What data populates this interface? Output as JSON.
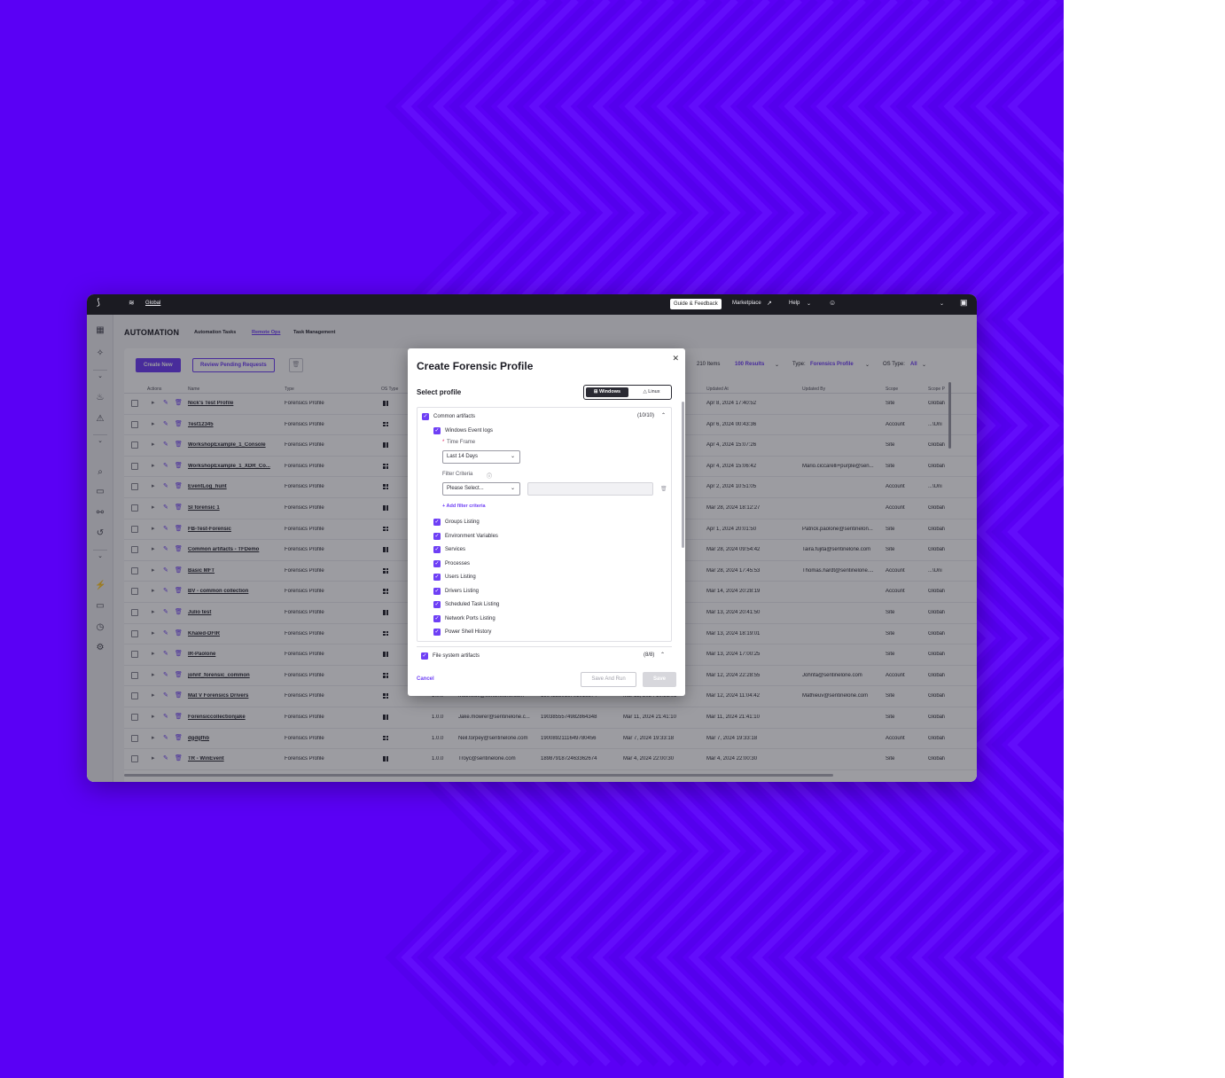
{
  "topbar": {
    "scope_label": "Global",
    "guide_label": "Guide & Feedback",
    "marketplace_label": "Marketplace",
    "help_label": "Help"
  },
  "page": {
    "title": "AUTOMATION",
    "tabs": [
      {
        "label": "Automation Tasks"
      },
      {
        "label": "Remote Ops"
      },
      {
        "label": "Task Management"
      }
    ]
  },
  "toolbar": {
    "create_label": "Create New",
    "review_label": "Review Pending Requests",
    "items_count": "210 Items",
    "results_label": "100 Results",
    "type_label": "Type:",
    "type_value": "Forensics Profile",
    "os_label": "OS Type:",
    "os_value": "All"
  },
  "table": {
    "headers": {
      "actions": "Actions",
      "name": "Name",
      "type": "Type",
      "os_type": "OS Type",
      "updated_at": "Updated At",
      "updated_by": "Updated By",
      "scope": "Scope",
      "scope_path": "Scope P"
    },
    "rows": [
      {
        "name": "Nick's Test Profile",
        "type": "Forensics Profile",
        "version": "",
        "created_by": "",
        "id": "",
        "created_at": "",
        "updated_at": "Apr 8, 2024 17:40:52",
        "updated_by": "",
        "scope": "Site",
        "path": "Global\\"
      },
      {
        "name": "Test12345",
        "type": "Forensics Profile",
        "version": "",
        "created_by": "",
        "id": "",
        "created_at": "",
        "updated_at": "Apr 6, 2024 00:43:36",
        "updated_by": "",
        "scope": "Account",
        "path": "...\\Uni"
      },
      {
        "name": "WorkshopExample_1_Console",
        "type": "Forensics Profile",
        "version": "",
        "created_by": "",
        "id": "",
        "created_at": "",
        "updated_at": "Apr 4, 2024 15:07:26",
        "updated_by": "",
        "scope": "Site",
        "path": "Global\\"
      },
      {
        "name": "WorkshopExample_1_XDR_Co...",
        "type": "Forensics Profile",
        "version": "",
        "created_by": "",
        "id": "",
        "created_at": "",
        "updated_at": "Apr 4, 2024 15:06:42",
        "updated_by": "Mario.ciccarelli+purple@sen...",
        "scope": "Site",
        "path": "Global\\"
      },
      {
        "name": "EventLog_hunt",
        "type": "Forensics Profile",
        "version": "",
        "created_by": "",
        "id": "",
        "created_at": "",
        "updated_at": "Apr 2, 2024 10:51:05",
        "updated_by": "",
        "scope": "Account",
        "path": "...\\Uni"
      },
      {
        "name": "SI forensic 1",
        "type": "Forensics Profile",
        "version": "",
        "created_by": "",
        "id": "",
        "created_at": "",
        "updated_at": "Mar 28, 2024 18:12:27",
        "updated_by": "",
        "scope": "Account",
        "path": "Global\\"
      },
      {
        "name": "FB-Test-Forensic",
        "type": "Forensics Profile",
        "version": "",
        "created_by": "",
        "id": "",
        "created_at": "",
        "updated_at": "Apr 1, 2024 20:01:50",
        "updated_by": "Patrick.paolone@sentinelon...",
        "scope": "Site",
        "path": "Global\\"
      },
      {
        "name": "Common artifacts - TFDemo",
        "type": "Forensics Profile",
        "version": "",
        "created_by": "",
        "id": "",
        "created_at": "",
        "updated_at": "Mar 28, 2024 09:54:42",
        "updated_by": "Taira.fujita@sentinelone.com",
        "scope": "Site",
        "path": "Global\\"
      },
      {
        "name": "Basic MFT",
        "type": "Forensics Profile",
        "version": "",
        "created_by": "",
        "id": "",
        "created_at": "",
        "updated_at": "Mar 28, 2024 17:45:53",
        "updated_by": "Thomas.hardt@sentinelone....",
        "scope": "Account",
        "path": "...\\Uni"
      },
      {
        "name": "BV - common collection",
        "type": "Forensics Profile",
        "version": "",
        "created_by": "",
        "id": "",
        "created_at": "",
        "updated_at": "Mar 14, 2024 20:28:19",
        "updated_by": "",
        "scope": "Account",
        "path": "Global\\"
      },
      {
        "name": "Julio test",
        "type": "Forensics Profile",
        "version": "",
        "created_by": "",
        "id": "",
        "created_at": "",
        "updated_at": "Mar 13, 2024 20:41:50",
        "updated_by": "",
        "scope": "Site",
        "path": "Global\\"
      },
      {
        "name": "Khaled-DFIR",
        "type": "Forensics Profile",
        "version": "",
        "created_by": "",
        "id": "",
        "created_at": "",
        "updated_at": "Mar 13, 2024 18:19:01",
        "updated_by": "",
        "scope": "Site",
        "path": "Global\\"
      },
      {
        "name": "IR-Paolone",
        "type": "Forensics Profile",
        "version": "",
        "created_by": "",
        "id": "",
        "created_at": "",
        "updated_at": "Mar 13, 2024 17:00:25",
        "updated_by": "",
        "scope": "Site",
        "path": "Global\\"
      },
      {
        "name": "johnf_forensic_common",
        "type": "Forensics Profile",
        "version": "",
        "created_by": "",
        "id": "",
        "created_at": "",
        "updated_at": "Mar 12, 2024 22:28:55",
        "updated_by": "Johnfa@sentinelone.com",
        "scope": "Account",
        "path": "Global\\"
      },
      {
        "name": "Mat V Forensics Drivers",
        "type": "Forensics Profile",
        "version": "1.0.0",
        "created_by": "Mathieuv@sentinelone.com",
        "id": "1904238016701016574",
        "created_at": "Mar 12, 2024 10:21:01",
        "updated_at": "Mar 12, 2024 11:04:42",
        "updated_by": "Mathieuv@sentinelone.com",
        "scope": "Site",
        "path": "Global\\"
      },
      {
        "name": "Forensiccollectionjake",
        "type": "Forensics Profile",
        "version": "1.0.0",
        "created_by": "Jake.mowrer@sentinelone.c...",
        "id": "1903855574982864348",
        "created_at": "Mar 11, 2024 21:41:10",
        "updated_at": "Mar 11, 2024 21:41:10",
        "updated_by": "",
        "scope": "Site",
        "path": "Global\\"
      },
      {
        "name": "dgdgfhb",
        "type": "Forensics Profile",
        "version": "1.0.0",
        "created_by": "Neil.torpey@sentinelone.com",
        "id": "1900892111649780456",
        "created_at": "Mar 7, 2024 19:33:18",
        "updated_at": "Mar 7, 2024 19:33:18",
        "updated_by": "",
        "scope": "Account",
        "path": "Global\\"
      },
      {
        "name": "TR - WinEvent",
        "type": "Forensics Profile",
        "version": "1.0.0",
        "created_by": "Troyc@sentinelone.com",
        "id": "1898791872463362674",
        "created_at": "Mar 4, 2024 22:00:30",
        "updated_at": "Mar 4, 2024 22:00:30",
        "updated_by": "",
        "scope": "Site",
        "path": "Global\\"
      }
    ]
  },
  "modal": {
    "title": "Create Forensic Profile",
    "select_profile": "Select profile",
    "seg_windows": "Windows",
    "seg_linux": "Linux",
    "common_label": "Common artifacts",
    "common_count": "(10/10)",
    "event_logs_label": "Windows Event logs",
    "time_frame_label": "Time Frame",
    "time_frame_value": "Last 14 Days",
    "filter_label": "Filter Criteria",
    "filter_value": "Please Select...",
    "add_filter_label": "Add filter criteria",
    "items": [
      {
        "label": "Groups Listing"
      },
      {
        "label": "Environment Variables"
      },
      {
        "label": "Services"
      },
      {
        "label": "Processes"
      },
      {
        "label": "Users Listing"
      },
      {
        "label": "Drivers Listing"
      },
      {
        "label": "Scheduled Task Listing"
      },
      {
        "label": "Network Ports Listing"
      },
      {
        "label": "Power Shell History"
      }
    ],
    "fs_label": "File system artifacts",
    "fs_count": "(8/8)",
    "cancel_label": "Cancel",
    "save_run_label": "Save And Run",
    "save_label": "Save"
  }
}
